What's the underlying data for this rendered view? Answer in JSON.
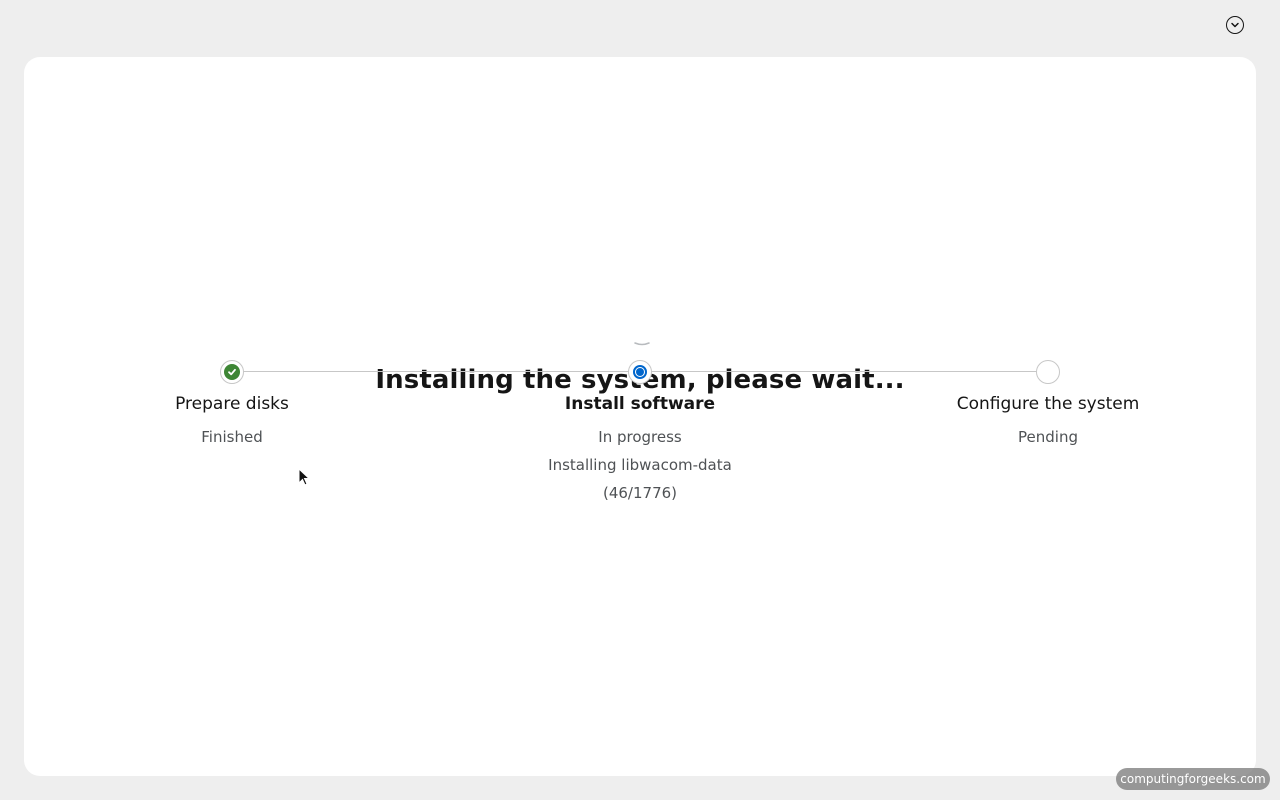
{
  "page": {
    "title": "Installing the system, please wait..."
  },
  "header": {
    "menu_icon": "chevron-down-circle-icon"
  },
  "progress_steps": [
    {
      "label": "Prepare disks",
      "status": "Finished",
      "detail": "",
      "icon": "check-circle-icon"
    },
    {
      "label": "Install software",
      "status": "In progress",
      "detail": "Installing libwacom-data",
      "counter": "(46/1776)",
      "icon": "radio-active-icon"
    },
    {
      "label": "Configure the system",
      "status": "Pending",
      "detail": "",
      "icon": "empty-circle-icon"
    }
  ],
  "watermark": {
    "text": "computingforgeeks.com"
  },
  "colors": {
    "accent": "#0066cc",
    "success": "#3e8635",
    "background": "#eeeeee",
    "card": "#ffffff"
  }
}
